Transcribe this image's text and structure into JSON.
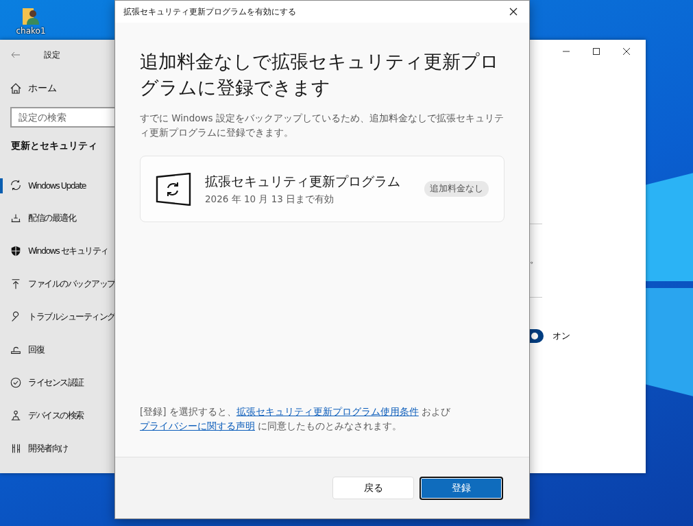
{
  "desktop": {
    "icons": [
      {
        "label": "chako1"
      }
    ]
  },
  "settings_window": {
    "title": "設定",
    "home": "ホーム",
    "search": {
      "placeholder": "設定の検索"
    },
    "section": "更新とセキュリティ",
    "items": [
      {
        "label": "Windows Update",
        "selected": true
      },
      {
        "label": "配信の最適化",
        "selected": false
      },
      {
        "label": "Windows セキュリティ",
        "selected": false
      },
      {
        "label": "ファイルのバックアップ",
        "selected": false
      },
      {
        "label": "トラブルシューティング",
        "selected": false
      },
      {
        "label": "回復",
        "selected": false
      },
      {
        "label": "ライセンス認証",
        "selected": false
      },
      {
        "label": "デバイスの検索",
        "selected": false
      },
      {
        "label": "開発者向け",
        "selected": false
      }
    ],
    "content_fragment": "。",
    "toggle": {
      "on": true,
      "label": "オン"
    }
  },
  "dialog": {
    "title": "拡張セキュリティ更新プログラムを有効にする",
    "heading": "追加料金なしで拡張セキュリティ更新プログラムに登録できます",
    "description": "すでに Windows 設定をバックアップしているため、追加料金なしで拡張セキュリティ更新プログラムに登録できます。",
    "card": {
      "title": "拡張セキュリティ更新プログラム",
      "subtitle": "2026 年 10 月 13 日まで有効",
      "badge": "追加料金なし"
    },
    "legal": [
      {
        "kind": "text",
        "text": "[登録] を選択すると、"
      },
      {
        "kind": "link",
        "text": "拡張セキュリティ更新プログラム使用条件"
      },
      {
        "kind": "text",
        "text": " および "
      },
      {
        "kind": "link",
        "text": "プライバシーに関する声明"
      },
      {
        "kind": "text",
        "text": " に同意したものとみなされます。"
      }
    ],
    "buttons": [
      {
        "label": "戻る",
        "kind": "secondary"
      },
      {
        "label": "登録",
        "kind": "primary"
      }
    ]
  }
}
